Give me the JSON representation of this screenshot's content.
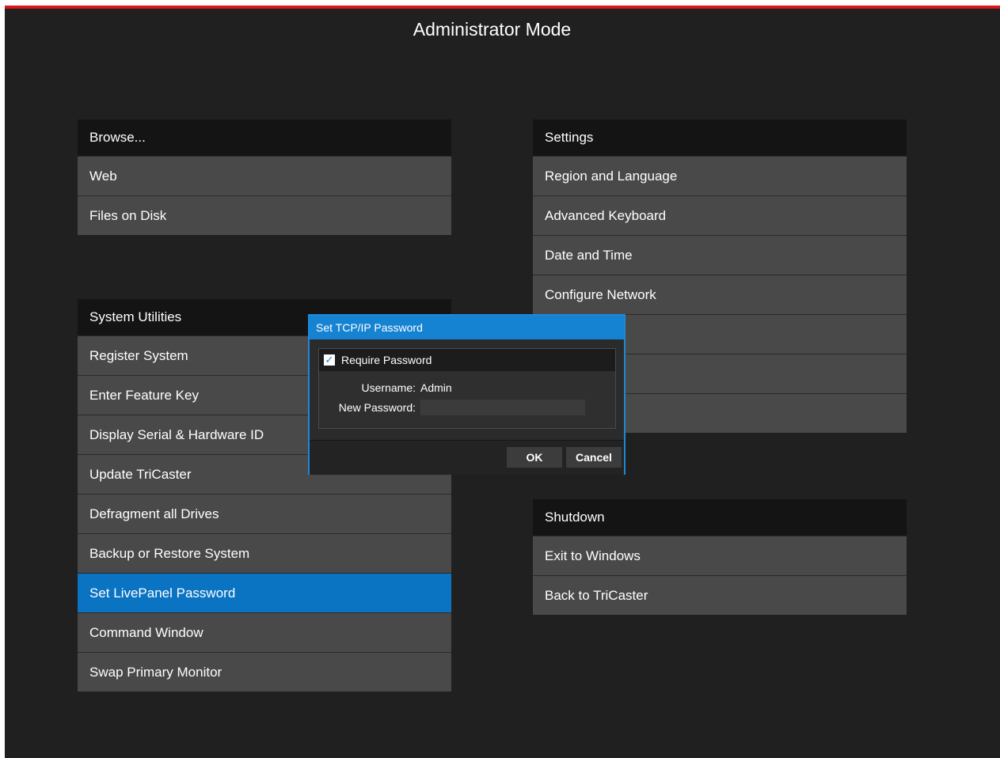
{
  "title": "Administrator Mode",
  "browse": {
    "header": "Browse...",
    "items": [
      "Web",
      "Files on Disk"
    ]
  },
  "settings": {
    "header": "Settings",
    "items": [
      "Region and Language",
      "Advanced Keyboard",
      "Date and Time",
      "Configure Network",
      "",
      "",
      ""
    ]
  },
  "system_utilities": {
    "header": "System Utilities",
    "items": [
      "Register System",
      "Enter Feature Key",
      "Display Serial & Hardware ID",
      "Update TriCaster",
      "Defragment all Drives",
      "Backup or Restore System",
      "Set LivePanel Password",
      "Command Window",
      "Swap Primary Monitor"
    ],
    "selected": "Set LivePanel Password"
  },
  "shutdown": {
    "header": "Shutdown",
    "items": [
      "Exit to Windows",
      "Back to TriCaster"
    ]
  },
  "dialog": {
    "title": "Set TCP/IP Password",
    "require_password_label": "Require Password",
    "require_password_checked": true,
    "username_label": "Username:",
    "username_value": "Admin",
    "new_password_label": "New Password:",
    "new_password_value": "",
    "ok_label": "OK",
    "cancel_label": "Cancel"
  },
  "colors": {
    "accent_red": "#d9161c",
    "selection_blue": "#0a73c2",
    "dialog_blue": "#1683d2",
    "background": "#202020",
    "item": "#494949"
  }
}
